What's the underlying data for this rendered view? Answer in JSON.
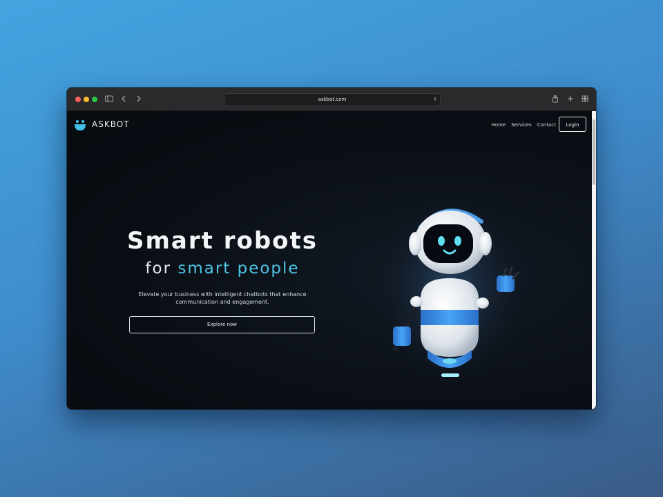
{
  "browser": {
    "url": "askbot.com",
    "colors": {
      "close": "#ff5f57",
      "minimize": "#febc2e",
      "zoom": "#28c840"
    }
  },
  "site": {
    "brand": "ASKBOT",
    "nav": {
      "home": "Home",
      "services": "Services",
      "contact": "Contact"
    },
    "login_label": "Login",
    "hero": {
      "title": "Smart robots",
      "subtitle_prefix": "for ",
      "subtitle_accent": "smart people",
      "description": "Elevate your business with intelligent chatbots that enhance communication and engagement.",
      "cta_label": "Explore now"
    },
    "colors": {
      "accent": "#4ec6e6",
      "logo": "#3fc1e9",
      "robot_blue": "#2f8be8"
    }
  }
}
